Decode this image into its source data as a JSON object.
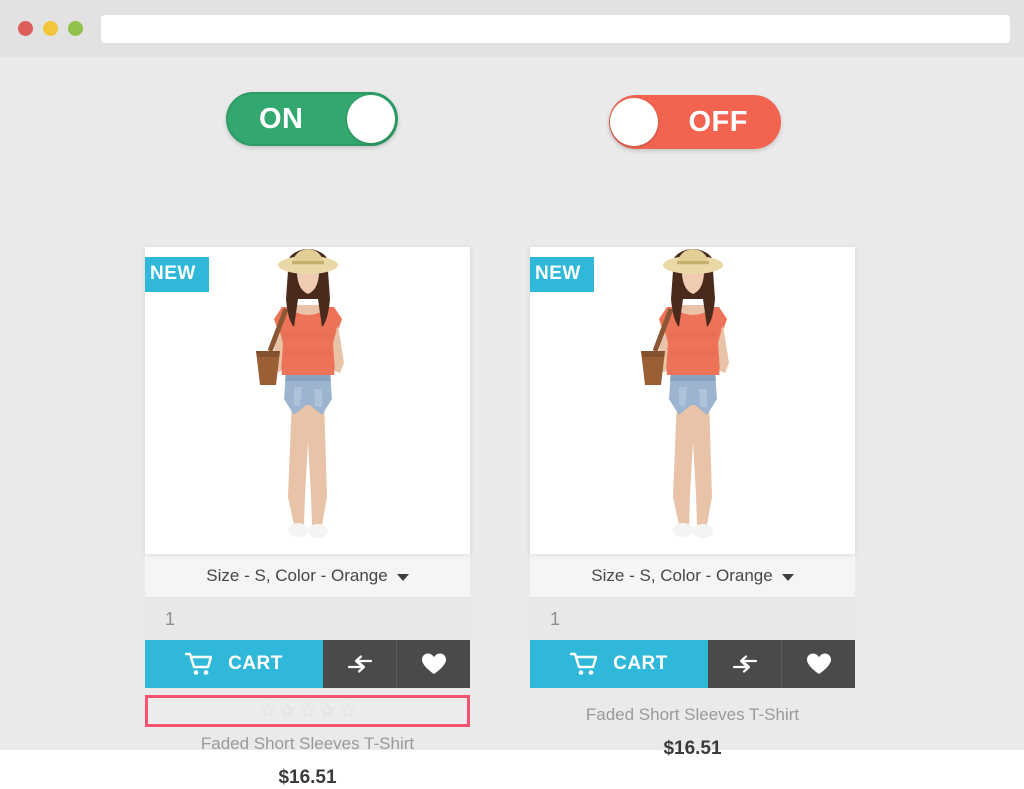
{
  "browser": {
    "url_value": "",
    "url_placeholder": "",
    "traffic_lights": [
      "close",
      "minimize",
      "maximize"
    ]
  },
  "toggles": [
    {
      "state_label": "ON",
      "state": "on",
      "color": "#33a86e"
    },
    {
      "state_label": "OFF",
      "state": "off",
      "color": "#f2644f"
    }
  ],
  "cards": [
    {
      "badge": "NEW",
      "image_alt": "Woman in straw hat, coral top and denim shorts",
      "variant_select": "Size - S, Color - Orange",
      "quantity": "1",
      "cart_label": "CART",
      "compare_icon": "compare-icon",
      "wishlist_icon": "heart-icon",
      "rating_stars": 5,
      "rating_filled": 0,
      "rating_highlighted": true,
      "highlight_color": "#f7526f",
      "name": "Faded Short Sleeves T-Shirt",
      "price": "$16.51"
    },
    {
      "badge": "NEW",
      "image_alt": "Woman in straw hat, coral top and denim shorts",
      "variant_select": "Size - S, Color - Orange",
      "quantity": "1",
      "cart_label": "CART",
      "compare_icon": "compare-icon",
      "wishlist_icon": "heart-icon",
      "rating_stars": 0,
      "rating_filled": 0,
      "rating_highlighted": false,
      "highlight_color": "",
      "name": "Faded Short Sleeves T-Shirt",
      "price": "$16.51"
    }
  ],
  "colors": {
    "accent_cyan": "#2fb8d9",
    "dark_button": "#4a4a4a",
    "page_background": "#eaeaea",
    "chrome_background": "#e2e2e2"
  }
}
